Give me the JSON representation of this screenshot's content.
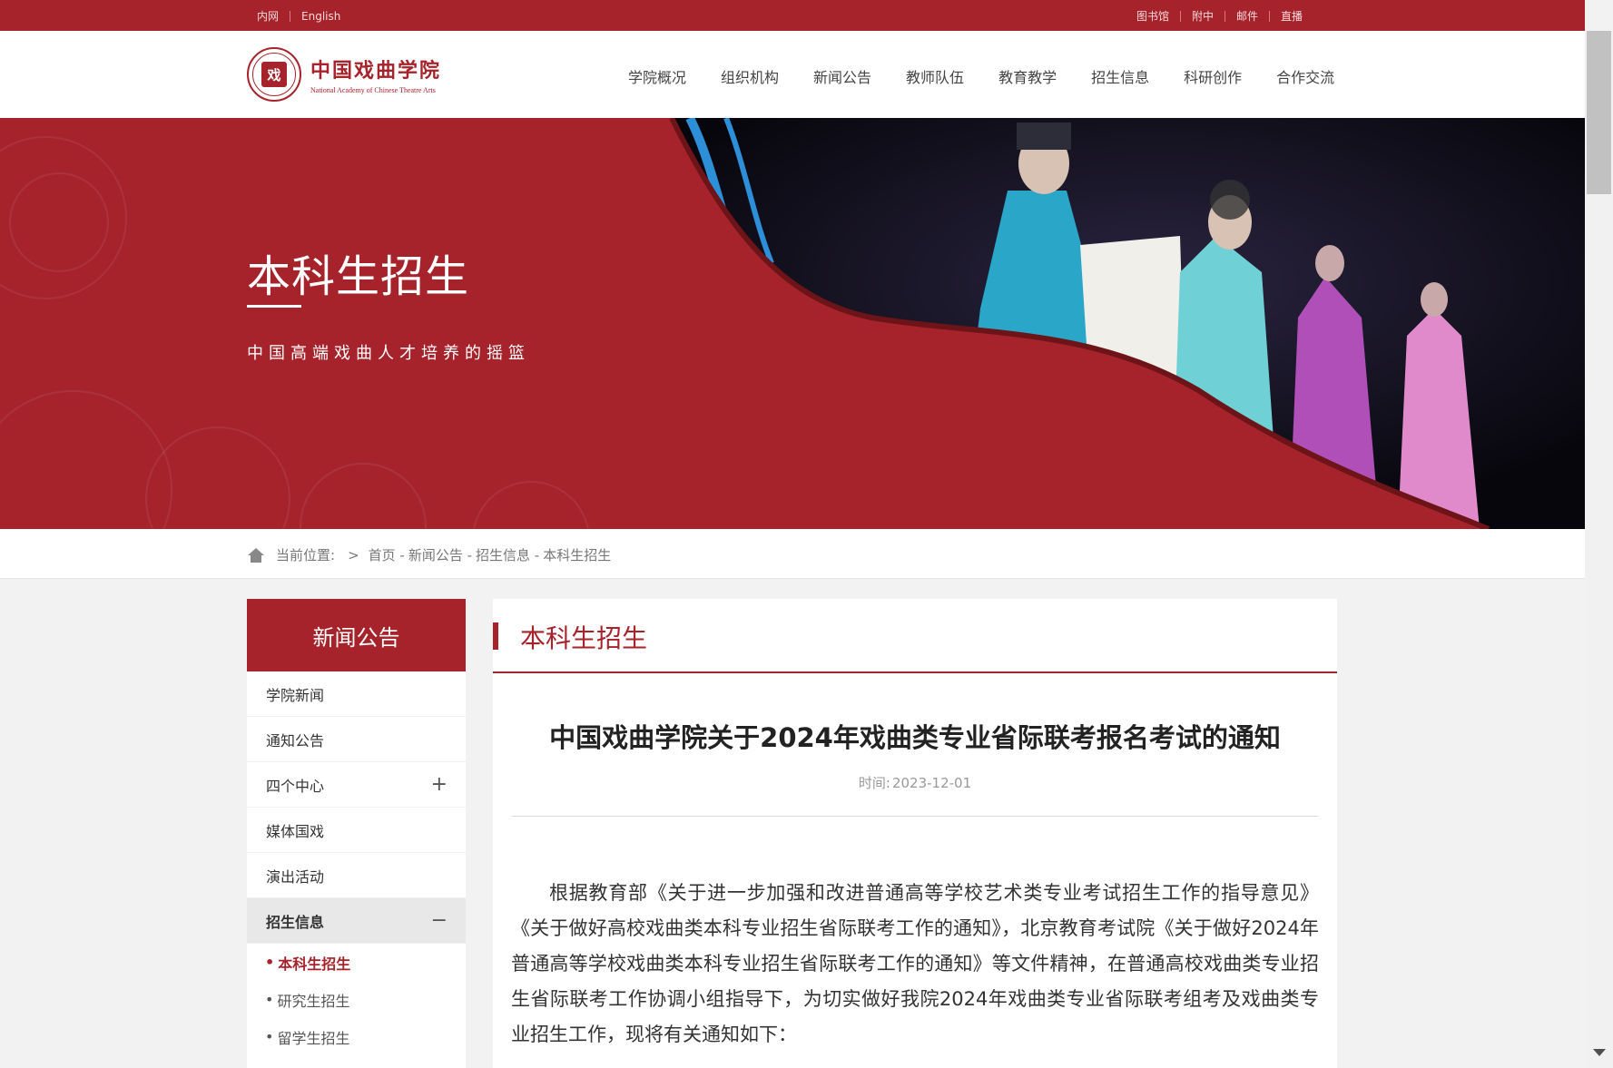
{
  "topbar": {
    "left_links": [
      "内网",
      "English"
    ],
    "right_links": [
      "图书馆",
      "附中",
      "邮件",
      "直播"
    ]
  },
  "header": {
    "logo_cn": "中国戏曲学院",
    "logo_en": "National Academy of Chinese Theatre Arts",
    "logo_seal_char": "戏",
    "nav": [
      "学院概况",
      "组织机构",
      "新闻公告",
      "教师队伍",
      "教育教学",
      "招生信息",
      "科研创作",
      "合作交流"
    ]
  },
  "banner": {
    "title": "本科生招生",
    "subtitle": "中国高端戏曲人才培养的摇篮"
  },
  "breadcrumb": {
    "label": "当前位置:",
    "arrow": ">",
    "items": [
      "首页 -",
      "新闻公告 -",
      "招生信息 -",
      "本科生招生"
    ]
  },
  "sidebar": {
    "heading": "新闻公告",
    "items": [
      {
        "label": "学院新闻",
        "sign": ""
      },
      {
        "label": "通知公告",
        "sign": ""
      },
      {
        "label": "四个中心",
        "sign": "+"
      },
      {
        "label": "媒体国戏",
        "sign": ""
      },
      {
        "label": "演出活动",
        "sign": ""
      },
      {
        "label": "招生信息",
        "sign": "−"
      }
    ],
    "subitems": [
      "本科生招生",
      "研究生招生",
      "留学生招生"
    ],
    "bullet": "•"
  },
  "content": {
    "section_title": "本科生招生",
    "article_title": "中国戏曲学院关于2024年戏曲类专业省际联考报名考试的通知",
    "date_label": "时间:",
    "date": "2023-12-01",
    "body": "根据教育部《关于进一步加强和改进普通高等学校艺术类专业考试招生工作的指导意见》《关于做好高校戏曲类本科专业招生省际联考工作的通知》，北京教育考试院《关于做好2024年普通高等学校戏曲类本科专业招生省际联考工作的通知》等文件精神，在普通高校戏曲类专业招生省际联考工作协调小组指导下，为切实做好我院2024年戏曲类专业省际联考组考及戏曲类专业招生工作，现将有关通知如下："
  },
  "colors": {
    "brand_red": "#a6232b",
    "background": "#f2f2f2"
  }
}
